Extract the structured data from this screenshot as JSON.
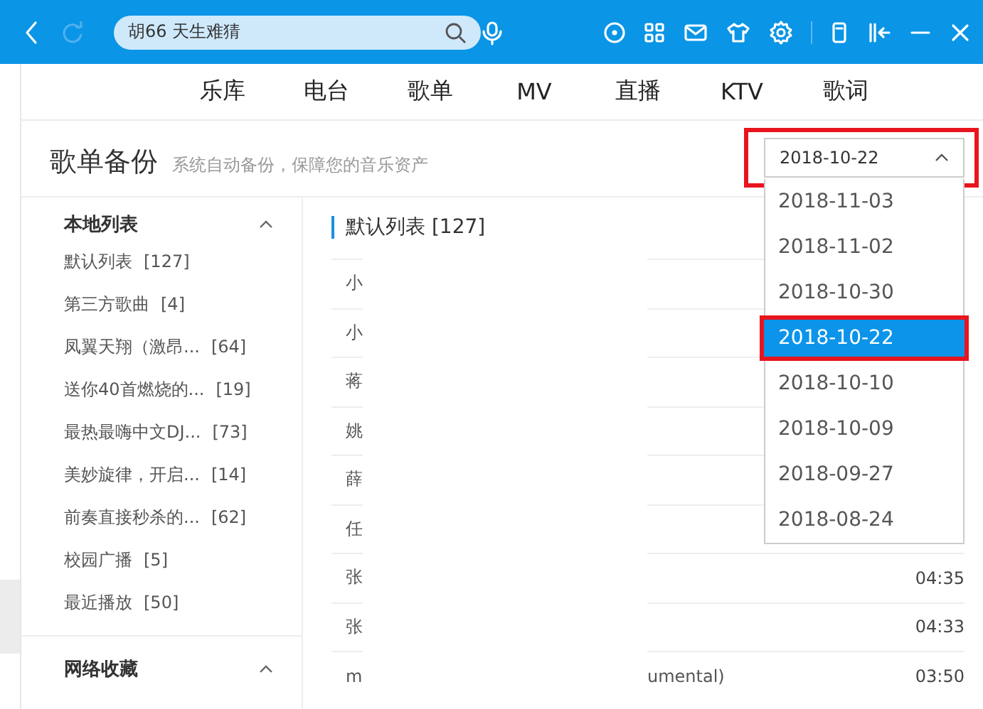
{
  "top_bar": {
    "search": {
      "value": "胡66 天生难猜"
    },
    "refresh_disabled": true
  },
  "nav_tabs": [
    {
      "label": "乐库"
    },
    {
      "label": "电台"
    },
    {
      "label": "歌单"
    },
    {
      "label": "MV"
    },
    {
      "label": "直播"
    },
    {
      "label": "KTV"
    },
    {
      "label": "歌词"
    }
  ],
  "header": {
    "title": "歌单备份",
    "subtitle": "系统自动备份，保障您的音乐资产"
  },
  "date_select": {
    "value": "2018-10-22",
    "expanded": true,
    "highlighted": true,
    "options": [
      {
        "label": "2018-11-03",
        "selected": false,
        "highlighted": false
      },
      {
        "label": "2018-11-02",
        "selected": false,
        "highlighted": false
      },
      {
        "label": "2018-10-30",
        "selected": false,
        "highlighted": false
      },
      {
        "label": "2018-10-22",
        "selected": true,
        "highlighted": true
      },
      {
        "label": "2018-10-10",
        "selected": false,
        "highlighted": false
      },
      {
        "label": "2018-10-09",
        "selected": false,
        "highlighted": false
      },
      {
        "label": "2018-09-27",
        "selected": false,
        "highlighted": false
      },
      {
        "label": "2018-08-24",
        "selected": false,
        "highlighted": false
      }
    ]
  },
  "sidebar": {
    "sections": [
      {
        "title": "本地列表",
        "expanded": true,
        "items": [
          {
            "name": "默认列表",
            "count": "[127]"
          },
          {
            "name": "第三方歌曲",
            "count": "[4]"
          },
          {
            "name": "凤翼天翔（激昂...",
            "count": "[64]"
          },
          {
            "name": "送你40首燃烧的...",
            "count": "[19]"
          },
          {
            "name": "最热最嗨中文DJ...",
            "count": "[73]"
          },
          {
            "name": "美妙旋律，开启...",
            "count": "[14]"
          },
          {
            "name": "前奏直接秒杀的...",
            "count": "[62]"
          },
          {
            "name": "校园广播",
            "count": "[5]"
          },
          {
            "name": "最近播放",
            "count": "[50]"
          }
        ]
      },
      {
        "title": "网络收藏",
        "expanded": true
      }
    ]
  },
  "song_list": {
    "title": "默认列表 [127]",
    "rows": [
      {
        "column_1": "小"
      },
      {
        "column_1": "小"
      },
      {
        "column_1": "蒋"
      },
      {
        "column_1": "姚"
      },
      {
        "column_1": "薛"
      },
      {
        "column_1": "任"
      },
      {
        "column_1": "张",
        "duration": "04:35"
      },
      {
        "column_1": "张",
        "duration": "04:33"
      },
      {
        "column_1": "m",
        "column_2": "umental)",
        "duration": "03:50"
      }
    ]
  }
}
